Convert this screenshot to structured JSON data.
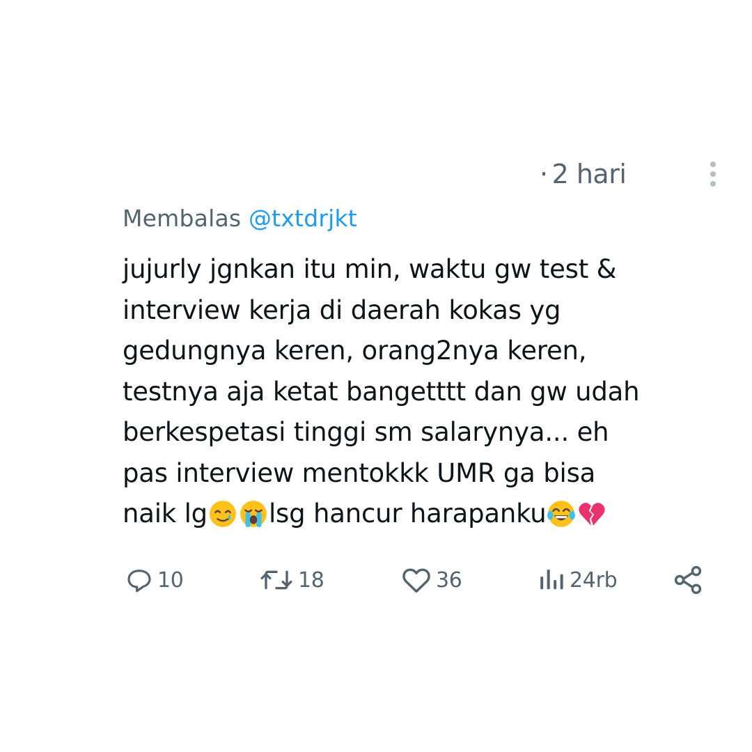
{
  "tweet": {
    "time_separator": "·",
    "time": "2 hari",
    "reply_prefix": "Membalas",
    "reply_handle": "@txtdrjkt",
    "text_lines": [
      "jujurly jgnkan itu min, waktu gw test &",
      "interview kerja di daerah kokas yg",
      "gedungnya keren, orang2nya keren,",
      "testnya aja ketat bangetttt dan gw udah",
      "berkespetasi tinggi sm salarynya... eh",
      "pas interview mentokkk UMR ga bisa",
      "naik lg",
      "lsg hancur harapanku"
    ],
    "emojis": [
      "smiling-face-with-tear",
      "loudly-crying-face",
      "face-with-tears-of-joy",
      "broken-heart"
    ]
  },
  "actions": {
    "reply_count": "10",
    "retweet_count": "18",
    "like_count": "36",
    "views_count": "24rb"
  },
  "colors": {
    "text": "#0f1419",
    "secondary": "#536471",
    "link": "#1d9bf0",
    "heart_emoji": "#e8336d"
  },
  "icons": [
    "more-vertical-icon",
    "reply-icon",
    "retweet-icon",
    "like-icon",
    "views-icon",
    "share-icon"
  ]
}
